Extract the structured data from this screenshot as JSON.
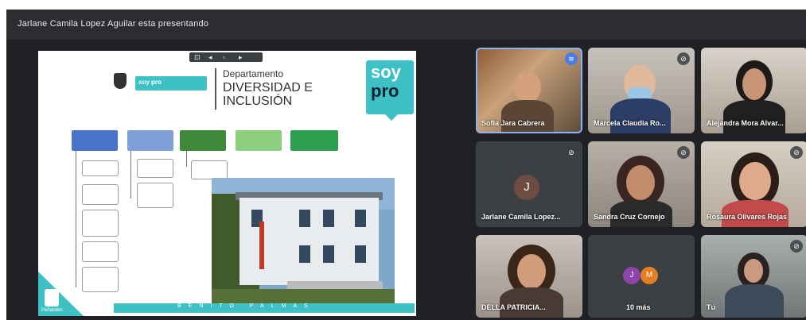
{
  "meeting": {
    "presenting_banner": "Jarlane Camila Lopez Aguilar esta presentando"
  },
  "slide": {
    "title_small": "Departamento",
    "title_line1": "DIVERSIDAD E",
    "title_line2": "INCLUSIÓN",
    "brand_top": "soy",
    "brand_bottom": "pro",
    "tag_label": "soy pro",
    "footer_text": "BENITO PALMAS",
    "corner_label": "Peñalolén"
  },
  "participants": [
    {
      "name": "Sofia Jara Cabrera",
      "mic": "mic-icon",
      "speaking": true
    },
    {
      "name": "Marcela Claudia Ro...",
      "mic": "mic-off-icon"
    },
    {
      "name": "Alejandra Mora Alvar...",
      "mic": "mic-off-icon"
    },
    {
      "name": "Jarlane Camila Lopez...",
      "mic": "mic-off-icon",
      "initial": "J"
    },
    {
      "name": "Sandra Cruz Cornejo",
      "mic": "mic-off-icon"
    },
    {
      "name": "Rosaura Olivares Rojas",
      "mic": "mic-off-icon"
    },
    {
      "name": "DELLA PATRICIA...",
      "mic": "mic-off-icon"
    },
    {
      "name": "10 más",
      "others": [
        "J",
        "M"
      ]
    },
    {
      "name": "Tú",
      "mic": "mic-off-icon"
    }
  ],
  "colors": {
    "accent_teal": "#3ec1c5",
    "speaking_border": "#8ab4f8",
    "meet_bg": "#202124"
  }
}
